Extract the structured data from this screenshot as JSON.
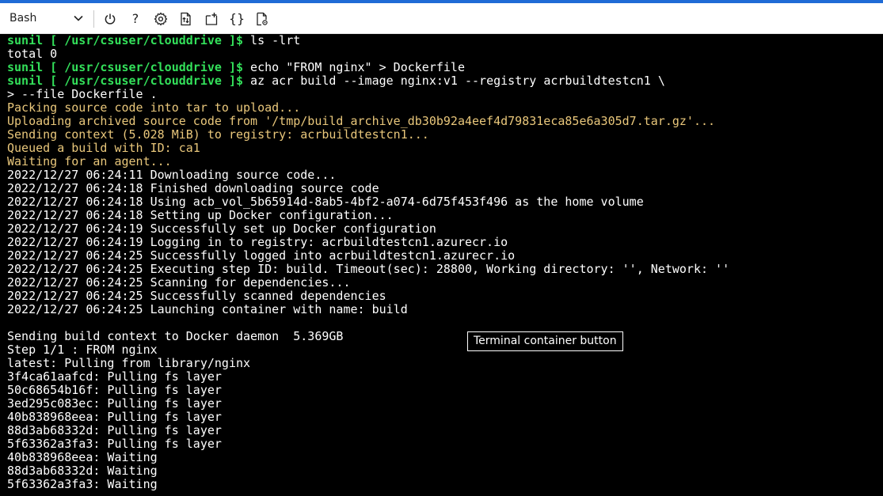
{
  "colors": {
    "accent": "#1f6bd6",
    "prompt_green": "#33e05a",
    "output_yellow": "#e9c77b",
    "terminal_bg": "#000000",
    "text_white": "#ffffff"
  },
  "window": {
    "grip_glyph": "···"
  },
  "toolbar": {
    "shell_selected": "Bash",
    "shell_icon": "chevron-down-icon",
    "buttons": [
      {
        "name": "restart",
        "icon": "power-icon"
      },
      {
        "name": "help",
        "text": "?"
      },
      {
        "name": "settings",
        "icon": "gear-icon"
      },
      {
        "name": "upload-download",
        "icon": "file-transfer-icon"
      },
      {
        "name": "new-session",
        "icon": "new-session-icon"
      },
      {
        "name": "editor",
        "text": "{}"
      },
      {
        "name": "web-preview",
        "icon": "web-preview-icon"
      }
    ]
  },
  "terminal": {
    "lines": [
      {
        "kind": "prompt",
        "user": "sunil",
        "path": " [ /usr/csuser/clouddrive ]$",
        "cmd": " ls -lrt"
      },
      {
        "kind": "out",
        "text": "total 0"
      },
      {
        "kind": "prompt",
        "user": "sunil",
        "path": " [ /usr/csuser/clouddrive ]$",
        "cmd": " echo \"FROM nginx\" > Dockerfile"
      },
      {
        "kind": "prompt",
        "user": "sunil",
        "path": " [ /usr/csuser/clouddrive ]$",
        "cmd": " az acr build --image nginx:v1 --registry acrbuildtestcn1 \\"
      },
      {
        "kind": "out",
        "text": "> --file Dockerfile ."
      },
      {
        "kind": "warn",
        "text": "Packing source code into tar to upload..."
      },
      {
        "kind": "warn",
        "text": "Uploading archived source code from '/tmp/build_archive_db30b92a4eef4d79831eca85e6a305d7.tar.gz'..."
      },
      {
        "kind": "warn",
        "text": "Sending context (5.028 MiB) to registry: acrbuildtestcn1..."
      },
      {
        "kind": "warn",
        "text": "Queued a build with ID: ca1"
      },
      {
        "kind": "warn",
        "text": "Waiting for an agent..."
      },
      {
        "kind": "out",
        "text": "2022/12/27 06:24:11 Downloading source code..."
      },
      {
        "kind": "out",
        "text": "2022/12/27 06:24:18 Finished downloading source code"
      },
      {
        "kind": "out",
        "text": "2022/12/27 06:24:18 Using acb_vol_5b65914d-8ab5-4bf2-a074-6d75f453f496 as the home volume"
      },
      {
        "kind": "out",
        "text": "2022/12/27 06:24:18 Setting up Docker configuration..."
      },
      {
        "kind": "out",
        "text": "2022/12/27 06:24:19 Successfully set up Docker configuration"
      },
      {
        "kind": "out",
        "text": "2022/12/27 06:24:19 Logging in to registry: acrbuildtestcn1.azurecr.io"
      },
      {
        "kind": "out",
        "text": "2022/12/27 06:24:25 Successfully logged into acrbuildtestcn1.azurecr.io"
      },
      {
        "kind": "out",
        "text": "2022/12/27 06:24:25 Executing step ID: build. Timeout(sec): 28800, Working directory: '', Network: ''"
      },
      {
        "kind": "out",
        "text": "2022/12/27 06:24:25 Scanning for dependencies..."
      },
      {
        "kind": "out",
        "text": "2022/12/27 06:24:25 Successfully scanned dependencies"
      },
      {
        "kind": "out",
        "text": "2022/12/27 06:24:25 Launching container with name: build"
      },
      {
        "kind": "out",
        "text": ""
      },
      {
        "kind": "out",
        "text": "Sending build context to Docker daemon  5.369GB"
      },
      {
        "kind": "out",
        "text": "Step 1/1 : FROM nginx"
      },
      {
        "kind": "out",
        "text": "latest: Pulling from library/nginx"
      },
      {
        "kind": "out",
        "text": "3f4ca61aafcd: Pulling fs layer"
      },
      {
        "kind": "out",
        "text": "50c68654b16f: Pulling fs layer"
      },
      {
        "kind": "out",
        "text": "3ed295c083ec: Pulling fs layer"
      },
      {
        "kind": "out",
        "text": "40b838968eea: Pulling fs layer"
      },
      {
        "kind": "out",
        "text": "88d3ab68332d: Pulling fs layer"
      },
      {
        "kind": "out",
        "text": "5f63362a3fa3: Pulling fs layer"
      },
      {
        "kind": "out",
        "text": "40b838968eea: Waiting"
      },
      {
        "kind": "out",
        "text": "88d3ab68332d: Waiting"
      },
      {
        "kind": "out",
        "text": "5f63362a3fa3: Waiting"
      }
    ]
  },
  "tooltip": {
    "text": "Terminal container button"
  }
}
